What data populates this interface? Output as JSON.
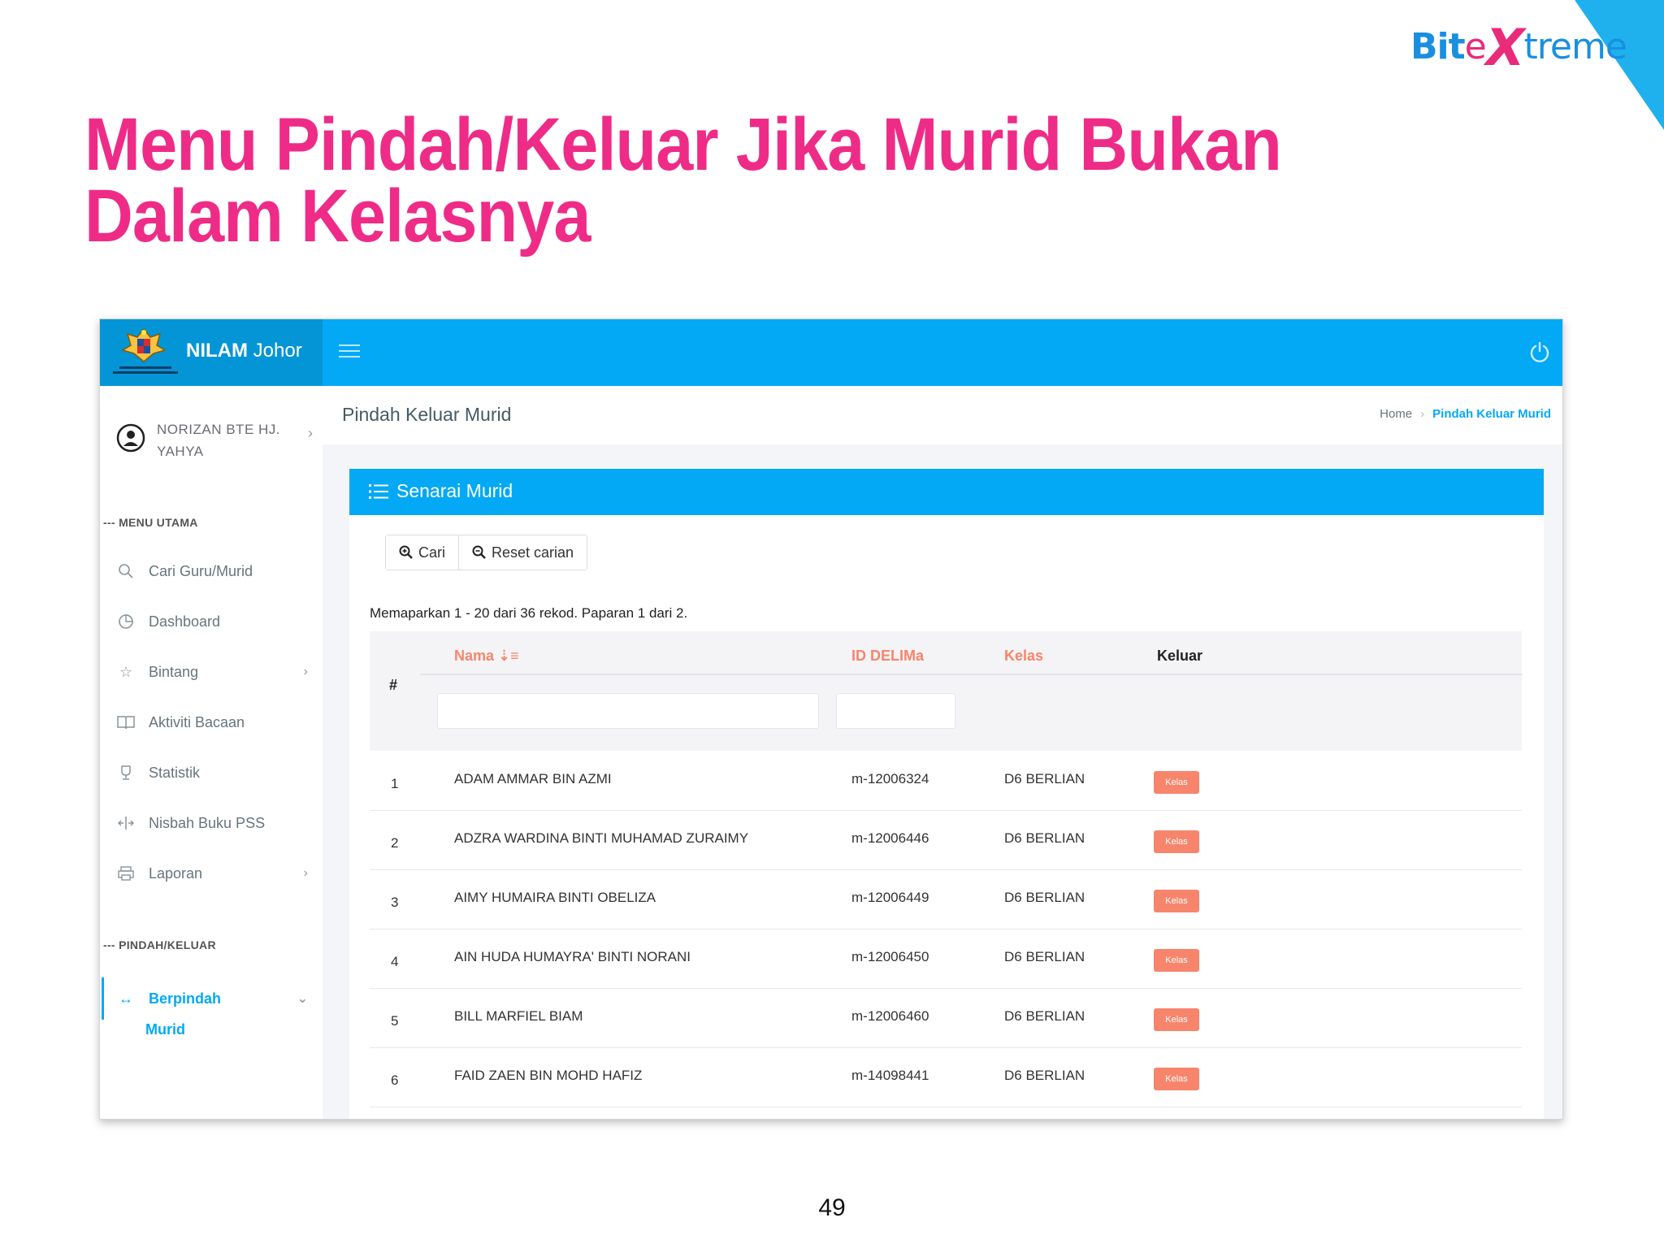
{
  "slide": {
    "title": "Menu Pindah/Keluar Jika Murid Bukan Dalam Kelasnya",
    "page_number": "49",
    "logo": {
      "bit": "Bit",
      "e": "e",
      "x": "X",
      "treme": "treme"
    },
    "accent_color": "#ee2c87"
  },
  "app": {
    "brand_bold": "NILAM",
    "brand_rest": "Johor",
    "primary_color": "#03a9f4"
  },
  "user": {
    "name": "NORIZAN BTE HJ. YAHYA"
  },
  "sidebar": {
    "section_main": "--- MENU UTAMA",
    "items": [
      {
        "label": "Cari Guru/Murid",
        "icon": "search-icon"
      },
      {
        "label": "Dashboard",
        "icon": "clock-icon"
      },
      {
        "label": "Bintang",
        "icon": "star-icon",
        "has_children": true
      },
      {
        "label": "Aktiviti Bacaan",
        "icon": "book-icon"
      },
      {
        "label": "Statistik",
        "icon": "trophy-icon"
      },
      {
        "label": "Nisbah Buku PSS",
        "icon": "ratio-icon"
      },
      {
        "label": "Laporan",
        "icon": "printer-icon",
        "has_children": true
      }
    ],
    "section_transfer": "--- PINDAH/KELUAR",
    "active_item": {
      "label": "Berpindah",
      "icon": "arrows-horizontal-icon"
    },
    "sub_item": "Murid"
  },
  "header": {
    "page_title": "Pindah Keluar Murid",
    "breadcrumb_home": "Home",
    "breadcrumb_current": "Pindah Keluar Murid"
  },
  "card": {
    "title": "Senarai Murid",
    "search_button": "Cari",
    "reset_button": "Reset carian",
    "summary": "Memaparkan 1 - 20 dari 36 rekod. Paparan 1 dari 2.",
    "columns": {
      "hash": "#",
      "nama": "Nama",
      "id": "ID DELIMa",
      "kelas": "Kelas",
      "keluar": "Keluar"
    },
    "filters": {
      "nama": "",
      "id": ""
    },
    "rows": [
      {
        "no": "1",
        "nama": "ADAM AMMAR BIN AZMI",
        "id": "m-12006324",
        "kelas": "D6 BERLIAN",
        "action": "Kelas"
      },
      {
        "no": "2",
        "nama": "ADZRA WARDINA BINTI MUHAMAD ZURAIMY",
        "id": "m-12006446",
        "kelas": "D6 BERLIAN",
        "action": "Kelas"
      },
      {
        "no": "3",
        "nama": "AIMY HUMAIRA BINTI OBELIZA",
        "id": "m-12006449",
        "kelas": "D6 BERLIAN",
        "action": "Kelas"
      },
      {
        "no": "4",
        "nama": "AIN HUDA HUMAYRA' BINTI NORANI",
        "id": "m-12006450",
        "kelas": "D6 BERLIAN",
        "action": "Kelas"
      },
      {
        "no": "5",
        "nama": "BILL MARFIEL BIAM",
        "id": "m-12006460",
        "kelas": "D6 BERLIAN",
        "action": "Kelas"
      },
      {
        "no": "6",
        "nama": "FAID ZAEN BIN MOHD HAFIZ",
        "id": "m-14098441",
        "kelas": "D6 BERLIAN",
        "action": "Kelas"
      }
    ]
  }
}
